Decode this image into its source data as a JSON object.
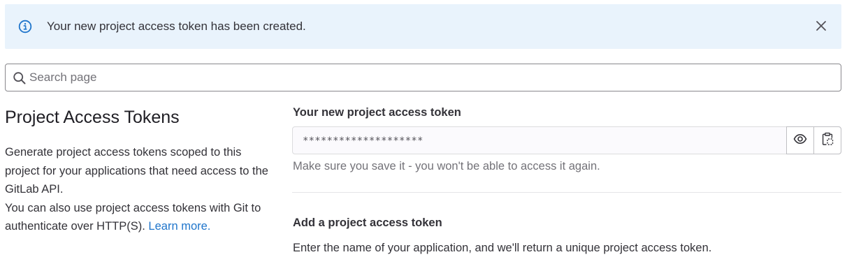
{
  "alert": {
    "message": "Your new project access token has been created.",
    "icon": "info-icon",
    "dismiss_icon": "close-icon",
    "background": "#e9f3fc",
    "accent": "#1f75cb"
  },
  "search": {
    "placeholder": "Search page",
    "value": ""
  },
  "sidebar": {
    "title": "Project Access Tokens",
    "description_1": "Generate project access tokens scoped to this project for your applications that need access to the GitLab API.",
    "description_2": "You can also use project access tokens with Git to authenticate over HTTP(S).",
    "learn_more": "Learn more."
  },
  "new_token": {
    "label": "Your new project access token",
    "masked_value": "********************",
    "reveal_icon": "eye-icon",
    "copy_icon": "clipboard-icon",
    "help_text": "Make sure you save it - you won't be able to access it again."
  },
  "add_token": {
    "title": "Add a project access token",
    "description": "Enter the name of your application, and we'll return a unique project access token."
  },
  "colors": {
    "link": "#1f75cb",
    "text": "#333238",
    "muted": "#737278"
  }
}
